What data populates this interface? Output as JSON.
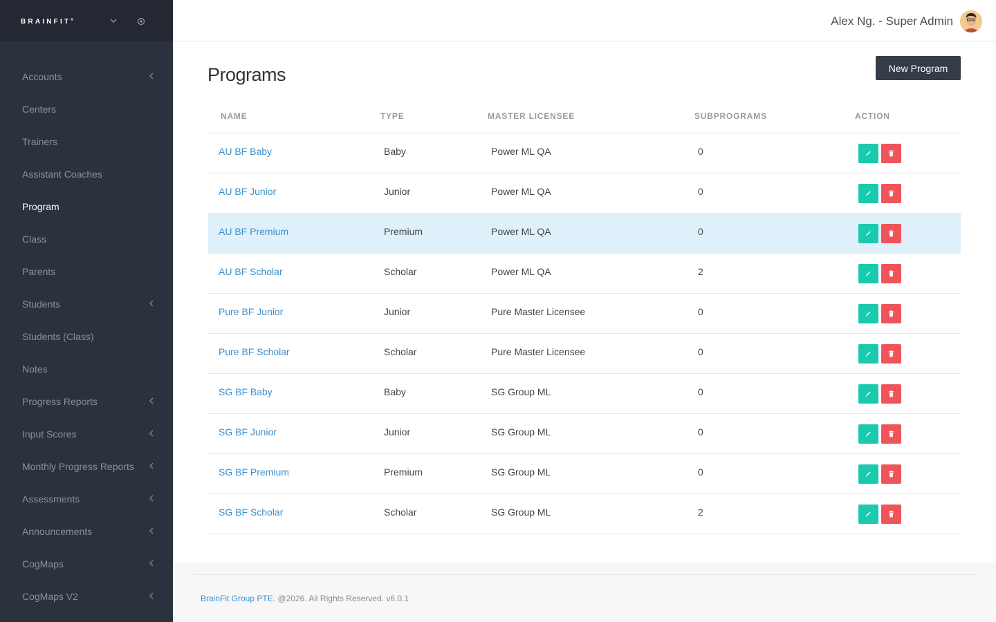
{
  "brand": {
    "name": "BRAINFIT",
    "mark": "®"
  },
  "user": {
    "name": "Alex Ng. - Super Admin"
  },
  "sidebar": {
    "items": [
      {
        "label": "Accounts",
        "has_submenu": true,
        "active": false
      },
      {
        "label": "Centers",
        "has_submenu": false,
        "active": false
      },
      {
        "label": "Trainers",
        "has_submenu": false,
        "active": false
      },
      {
        "label": "Assistant Coaches",
        "has_submenu": false,
        "active": false
      },
      {
        "label": "Program",
        "has_submenu": false,
        "active": true
      },
      {
        "label": "Class",
        "has_submenu": false,
        "active": false
      },
      {
        "label": "Parents",
        "has_submenu": false,
        "active": false
      },
      {
        "label": "Students",
        "has_submenu": true,
        "active": false
      },
      {
        "label": "Students (Class)",
        "has_submenu": false,
        "active": false
      },
      {
        "label": "Notes",
        "has_submenu": false,
        "active": false
      },
      {
        "label": "Progress Reports",
        "has_submenu": true,
        "active": false
      },
      {
        "label": "Input Scores",
        "has_submenu": true,
        "active": false
      },
      {
        "label": "Monthly Progress Reports",
        "has_submenu": true,
        "active": false
      },
      {
        "label": "Assessments",
        "has_submenu": true,
        "active": false
      },
      {
        "label": "Announcements",
        "has_submenu": true,
        "active": false
      },
      {
        "label": "CogMaps",
        "has_submenu": true,
        "active": false
      },
      {
        "label": "CogMaps V2",
        "has_submenu": true,
        "active": false
      }
    ]
  },
  "main": {
    "title": "Programs",
    "new_button": "New Program",
    "columns": {
      "name": "NAME",
      "type": "TYPE",
      "master": "MASTER LICENSEE",
      "sub": "SUBPROGRAMS",
      "action": "ACTION"
    },
    "rows": [
      {
        "name": "AU BF Baby",
        "type": "Baby",
        "master": "Power ML QA",
        "sub": "0",
        "highlight": false
      },
      {
        "name": "AU BF Junior",
        "type": "Junior",
        "master": "Power ML QA",
        "sub": "0",
        "highlight": false
      },
      {
        "name": "AU BF Premium",
        "type": "Premium",
        "master": "Power ML QA",
        "sub": "0",
        "highlight": true
      },
      {
        "name": "AU BF Scholar",
        "type": "Scholar",
        "master": "Power ML QA",
        "sub": "2",
        "highlight": false
      },
      {
        "name": "Pure BF Junior",
        "type": "Junior",
        "master": "Pure Master Licensee",
        "sub": "0",
        "highlight": false
      },
      {
        "name": "Pure BF Scholar",
        "type": "Scholar",
        "master": "Pure Master Licensee",
        "sub": "0",
        "highlight": false
      },
      {
        "name": "SG BF Baby",
        "type": "Baby",
        "master": "SG Group ML",
        "sub": "0",
        "highlight": false
      },
      {
        "name": "SG BF Junior",
        "type": "Junior",
        "master": "SG Group ML",
        "sub": "0",
        "highlight": false
      },
      {
        "name": "SG BF Premium",
        "type": "Premium",
        "master": "SG Group ML",
        "sub": "0",
        "highlight": false
      },
      {
        "name": "SG BF Scholar",
        "type": "Scholar",
        "master": "SG Group ML",
        "sub": "2",
        "highlight": false
      }
    ]
  },
  "footer": {
    "link": "BrainFit Group PTE.",
    "text": " @2026. All Rights Reserved. v6.0.1"
  },
  "icons": {
    "edit": "pencil-icon",
    "delete": "trash-icon",
    "submenu": "chevron-left-icon",
    "brand_toggle": "chevron-down-icon",
    "brand_settings": "target-icon"
  },
  "colors": {
    "sidebar": "#2b313d",
    "link": "#3a8fcd",
    "edit": "#1bc9ae",
    "delete": "#f0545b",
    "highlight": "#dff0fb",
    "primary_button": "#353c47"
  }
}
